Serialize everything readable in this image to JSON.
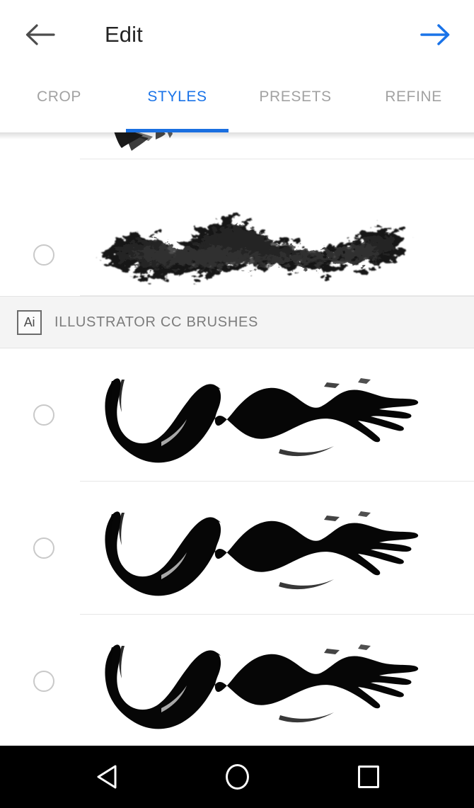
{
  "appbar": {
    "title": "Edit",
    "back_icon": "arrow-left-icon",
    "forward_icon": "arrow-right-icon",
    "back_color": "#4c4c4c",
    "forward_color": "#1a73e8",
    "title_color": "#242424"
  },
  "tabs": {
    "active_index": 1,
    "active_color": "#1a73e8",
    "inactive_color": "#a2a2a2",
    "indicator_color": "#1a6fe0",
    "items": [
      {
        "label": "CROP"
      },
      {
        "label": "STYLES"
      },
      {
        "label": "PRESETS"
      },
      {
        "label": "REFINE"
      }
    ]
  },
  "list": {
    "partial_top_item": {
      "name": "brush-preview-partial",
      "selected": false
    },
    "items_before_section": [
      {
        "name": "brush-preview-charcoal",
        "style": "fuzzy",
        "selected": false
      }
    ],
    "section": {
      "badge_text": "Ai",
      "badge_icon": "illustrator-icon",
      "title": "ILLUSTRATOR CC BRUSHES",
      "background": "#f4f4f4",
      "title_color": "#7c7c7c"
    },
    "items_after_section": [
      {
        "name": "brush-preview-ai-1",
        "style": "solid",
        "selected": false
      },
      {
        "name": "brush-preview-ai-2",
        "style": "solid",
        "selected": false
      },
      {
        "name": "brush-preview-ai-3",
        "style": "solid",
        "selected": false
      }
    ],
    "divider_color": "#e6e6e6",
    "radio_color": "#c9c9c9"
  },
  "navbar": {
    "background": "#000000",
    "icon_color": "#fafafa",
    "back_label": "back-triangle-icon",
    "home_label": "home-circle-icon",
    "recents_label": "recents-square-icon"
  }
}
